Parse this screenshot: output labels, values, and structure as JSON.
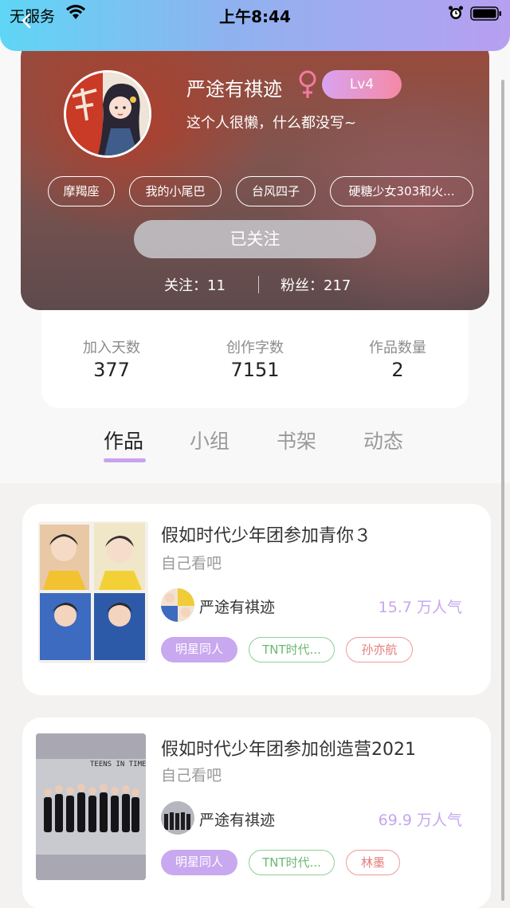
{
  "status_bar": {
    "carrier": "无服务",
    "time": "上午8:44"
  },
  "profile": {
    "username": "严途有祺迹",
    "level": "Lv4",
    "bio": "这个人很懒，什么都没写~",
    "tags": [
      "摩羯座",
      "我的小尾巴",
      "台风四子",
      "硬糖少女303和火..."
    ],
    "follow_button": "已关注",
    "following_label": "关注：",
    "following_count": "11",
    "fans_label": "粉丝：",
    "fans_count": "217"
  },
  "stats": [
    {
      "label": "加入天数",
      "value": "377"
    },
    {
      "label": "创作字数",
      "value": "7151"
    },
    {
      "label": "作品数量",
      "value": "2"
    }
  ],
  "tabs": [
    "作品",
    "小组",
    "书架",
    "动态"
  ],
  "active_tab": 0,
  "works": [
    {
      "title": "假如时代少年团参加青你３",
      "subtitle": "自己看吧",
      "author": "严途有祺迹",
      "popularity": "15.7 万人气",
      "tags": [
        {
          "text": "明星同人",
          "style": "purple"
        },
        {
          "text": "TNT时代...",
          "style": "green"
        },
        {
          "text": "孙亦航",
          "style": "red"
        }
      ]
    },
    {
      "title": "假如时代少年团参加创造营2021",
      "subtitle": "自己看吧",
      "author": "严途有祺迹",
      "popularity": "69.9 万人气",
      "cover_text": "TEENS IN TIMES",
      "tags": [
        {
          "text": "明星同人",
          "style": "purple"
        },
        {
          "text": "TNT时代...",
          "style": "green"
        },
        {
          "text": "林墨",
          "style": "red"
        }
      ]
    }
  ],
  "colors": {
    "accent_purple": "#c8a8ee",
    "tag_green": "#8fcf92",
    "tag_red": "#ee9a9a"
  }
}
